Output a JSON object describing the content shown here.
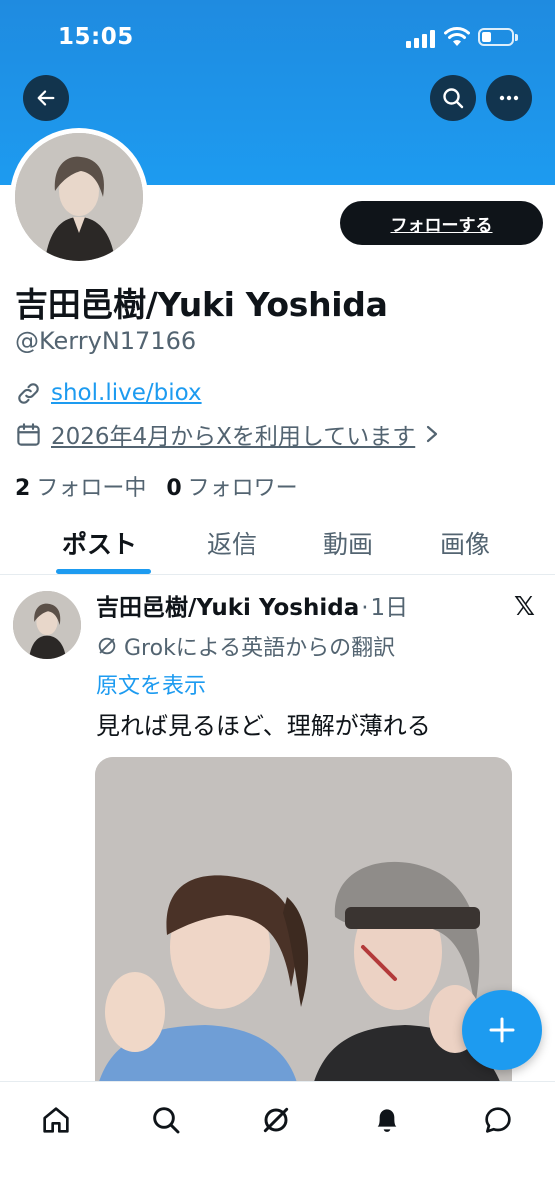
{
  "status_bar": {
    "time": "15:05"
  },
  "profile": {
    "name": "吉田邑樹/Yuki Yoshida",
    "handle": "@KerryN17166",
    "follow_label": "フォローする",
    "link": "shol.live/biox",
    "joined": "2026年4月からXを利用しています",
    "following_count": "2",
    "following_label": "フォロー中",
    "followers_count": "0",
    "followers_label": "フォロワー"
  },
  "tabs": [
    {
      "label": "ポスト",
      "active": true
    },
    {
      "label": "返信",
      "active": false
    },
    {
      "label": "動画",
      "active": false
    },
    {
      "label": "画像",
      "active": false
    }
  ],
  "post": {
    "author": "吉田邑樹/Yuki Yoshida",
    "separator": "·",
    "time": "1日",
    "translation_note": "Grokによる英語からの翻訳",
    "show_original": "原文を表示",
    "text": "見れば見るほど、理解が薄れる"
  },
  "icons": {
    "back": "arrow-left-icon",
    "search": "search-icon",
    "more": "more-icon",
    "link": "link-icon",
    "calendar": "calendar-icon",
    "grok": "grok-icon",
    "x_logo": "x-logo-icon",
    "compose": "plus-icon",
    "nav": [
      "home-icon",
      "search-icon",
      "grok-icon",
      "bell-icon",
      "chat-icon"
    ]
  },
  "colors": {
    "accent": "#1d9bf0",
    "banner": "#1d9bf0",
    "text": "#0f1419",
    "muted": "#536471",
    "follow_bg": "#0f1419"
  }
}
